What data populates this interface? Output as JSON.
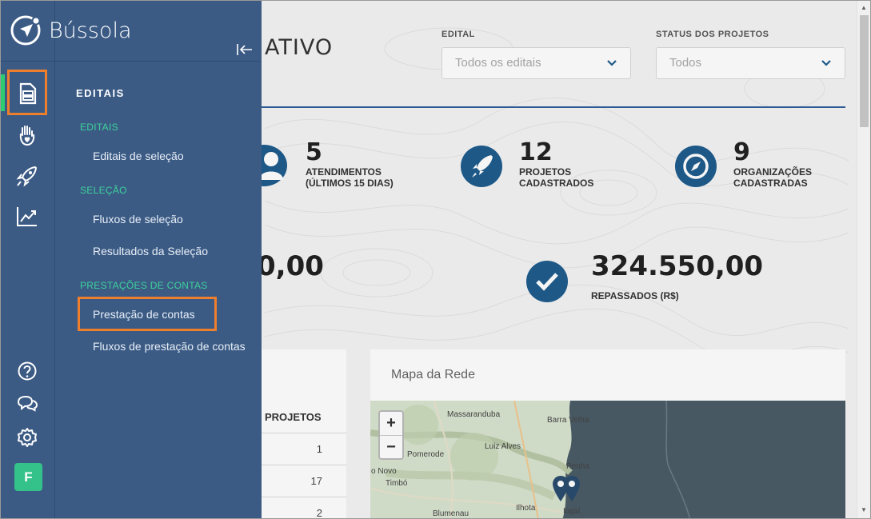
{
  "app": {
    "brand": "Bússola"
  },
  "header": {
    "title_partial": "ATIVO"
  },
  "filters": {
    "edital_label": "EDITAL",
    "edital_value": "Todos os editais",
    "status_label": "STATUS DOS PROJETOS",
    "status_value": "Todos"
  },
  "stats": [
    {
      "number": "5",
      "label1": "ATENDIMENTOS",
      "label2": "(ÚLTIMOS 15 DIAS)"
    },
    {
      "number": "12",
      "label1": "PROJETOS",
      "label2": "CADASTRADOS"
    },
    {
      "number": "9",
      "label1": "ORGANIZAÇÕES",
      "label2": "CADASTRADAS"
    }
  ],
  "money": [
    {
      "number": "0,00"
    },
    {
      "number": "324.550,00",
      "label": "REPASSADOS (R$)"
    }
  ],
  "table": {
    "header": "PROJETOS",
    "rows": [
      "1",
      "17",
      "2"
    ]
  },
  "map": {
    "title": "Mapa da Rede",
    "zoom_in": "+",
    "zoom_out": "−",
    "places": [
      "Massaranduba",
      "Barra Velha",
      "Luiz Alves",
      "Pomerode",
      "o Novo",
      "Penha",
      "Timbó",
      "Blumenau",
      "Ilhota",
      "Itajaí"
    ]
  },
  "menu": {
    "section": "EDITAIS",
    "groups": [
      {
        "label": "EDITAIS",
        "items": [
          "Editais de seleção"
        ]
      },
      {
        "label": "SELEÇÃO",
        "items": [
          "Fluxos de seleção",
          "Resultados da Seleção"
        ]
      },
      {
        "label": "PRESTAÇÕES DE CONTAS",
        "items": [
          "Prestação de contas",
          "Fluxos de prestação de contas"
        ]
      }
    ]
  },
  "rail_icons": [
    "document-icon",
    "hand-heart-icon",
    "rocket-icon",
    "chart-line-icon",
    "help-icon",
    "chat-icon",
    "gear-icon"
  ],
  "user": {
    "initial": "F"
  },
  "colors": {
    "sidebar": "#3b5b85",
    "accent_green": "#2ecc71",
    "highlight": "#ef7f2c",
    "stat_icon": "#1f5c8d"
  }
}
